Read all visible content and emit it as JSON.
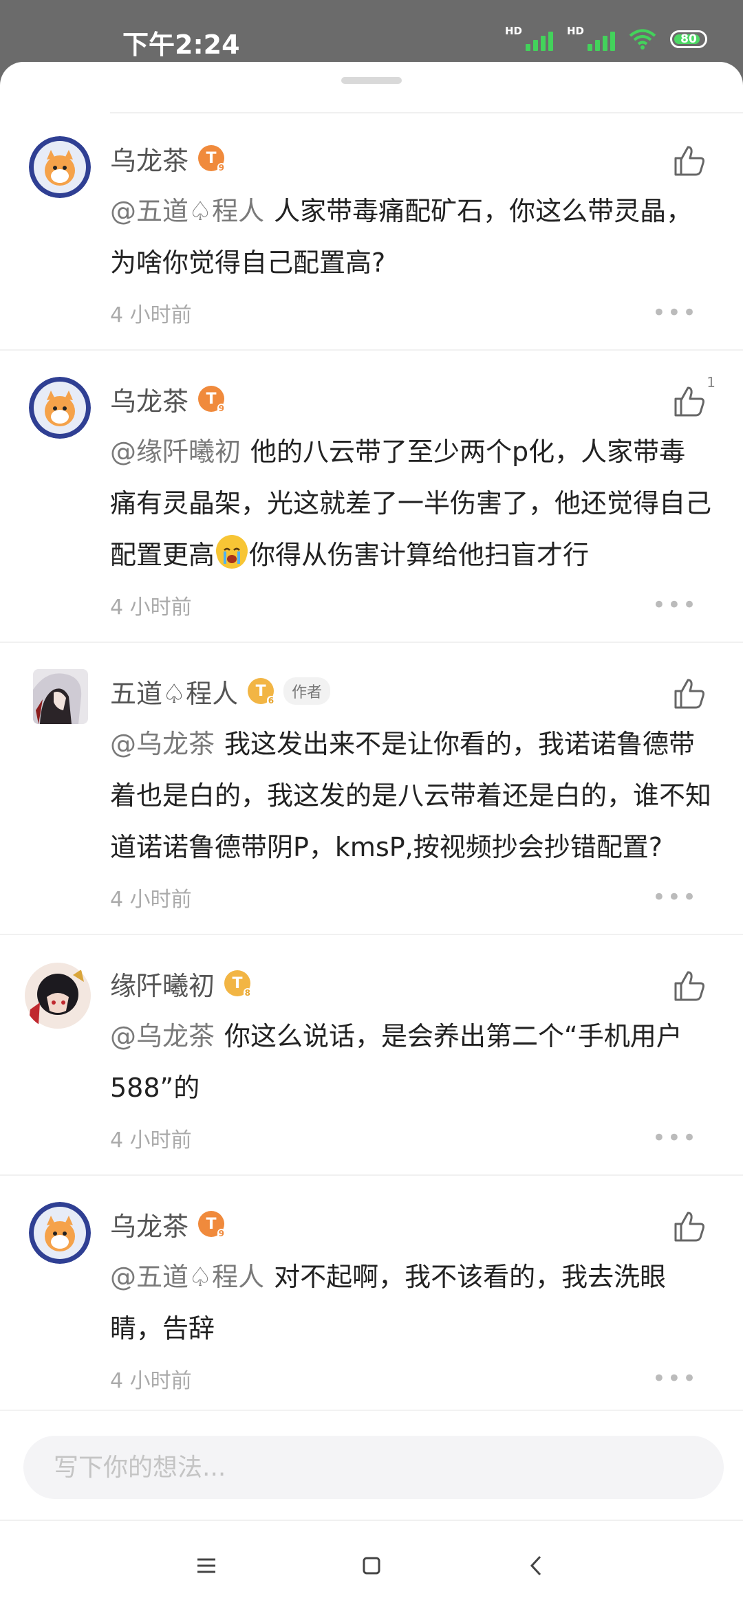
{
  "status_bar": {
    "time": "下午2:24",
    "hd1": "HD",
    "hd2": "HD",
    "battery": "80"
  },
  "comments": [
    {
      "user": "乌龙茶",
      "level": "T",
      "level_num": "9",
      "level_color": "orange",
      "mention": "@五道♤程人",
      "text": "人家带毒痛配矿石，你这么带灵晶，为啥你觉得自己配置高?",
      "time": "4 小时前",
      "likes": ""
    },
    {
      "user": "乌龙茶",
      "level": "T",
      "level_num": "9",
      "level_color": "orange",
      "mention": "@缘阡曦初",
      "text_a": "他的八云带了至少两个p化，人家带毒痛有灵晶架，光这就差了一半伤害了，他还觉得自己配置更高",
      "text_b": "你得从伤害计算给他扫盲才行",
      "time": "4 小时前",
      "likes": "1"
    },
    {
      "user": "五道♤程人",
      "level": "T",
      "level_num": "6",
      "level_color": "gold",
      "author_tag": "作者",
      "mention": "@乌龙茶",
      "text": "我这发出来不是让你看的，我诺诺鲁德带着也是白的，我这发的是八云带着还是白的，谁不知道诺诺鲁德带阴P，kmsP,按视频抄会抄错配置?",
      "time": "4 小时前",
      "likes": ""
    },
    {
      "user": "缘阡曦初",
      "level": "T",
      "level_num": "8",
      "level_color": "gold",
      "mention": "@乌龙茶",
      "text": "你这么说话，是会养出第二个“手机用户588”的",
      "time": "4 小时前",
      "likes": ""
    },
    {
      "user": "乌龙茶",
      "level": "T",
      "level_num": "9",
      "level_color": "orange",
      "mention": "@五道♤程人",
      "text": "对不起啊，我不该看的，我去洗眼睛，告辞",
      "time": "4 小时前",
      "likes": ""
    }
  ],
  "input": {
    "placeholder": "写下你的想法..."
  },
  "more_label": "•••",
  "icons": {
    "like": "thumbs-up-icon",
    "more": "more-dots-icon",
    "nav_menu": "menu-icon",
    "nav_home": "home-square-icon",
    "nav_back": "back-chevron-icon"
  },
  "colors": {
    "accent_orange": "#f08a3c",
    "gold": "#f2b544",
    "signal": "#43d25b"
  }
}
